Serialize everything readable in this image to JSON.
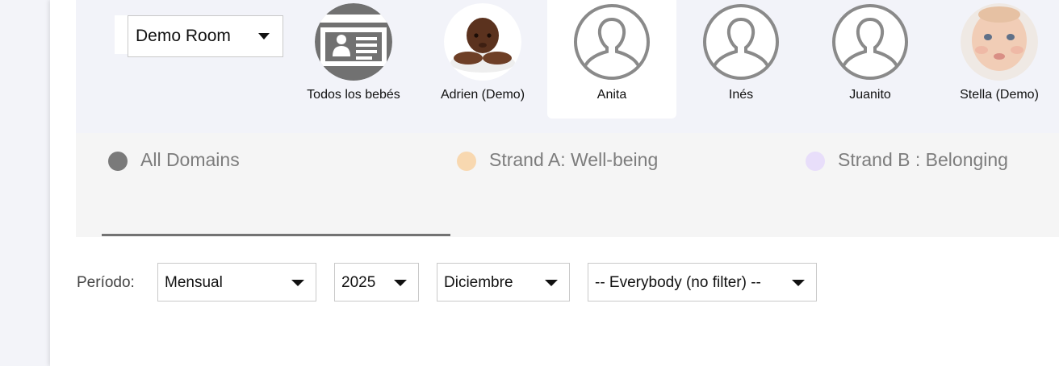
{
  "room_selector": {
    "value": "Demo Room"
  },
  "children": [
    {
      "name": "Todos los bebés",
      "avatar": "group-id-card-icon",
      "selected": false
    },
    {
      "name": "Adrien (Demo)",
      "avatar": "baby-photo",
      "selected": false
    },
    {
      "name": "Anita",
      "avatar": "person-placeholder-icon",
      "selected": true
    },
    {
      "name": "Inés",
      "avatar": "person-placeholder-icon",
      "selected": false
    },
    {
      "name": "Juanito",
      "avatar": "person-placeholder-icon",
      "selected": false
    },
    {
      "name": "Stella (Demo)",
      "avatar": "baby-photo",
      "selected": false
    }
  ],
  "domains": [
    {
      "label": "All Domains",
      "color": "#7a7a7a",
      "active": true
    },
    {
      "label": "Strand A: Well-being",
      "color": "#f8d8b0",
      "active": false
    },
    {
      "label": "Strand B : Belonging",
      "color": "#e8defa",
      "active": false
    }
  ],
  "filters": {
    "period_label": "Período:",
    "period": "Mensual",
    "year": "2025",
    "month": "Diciembre",
    "group": "-- Everybody (no filter) --"
  },
  "colors": {
    "header_bg": "#f2f3f9",
    "domain_bar_bg": "#f5f5f5",
    "active_underline": "#737373",
    "avatar_gray": "#8a8a8a"
  }
}
